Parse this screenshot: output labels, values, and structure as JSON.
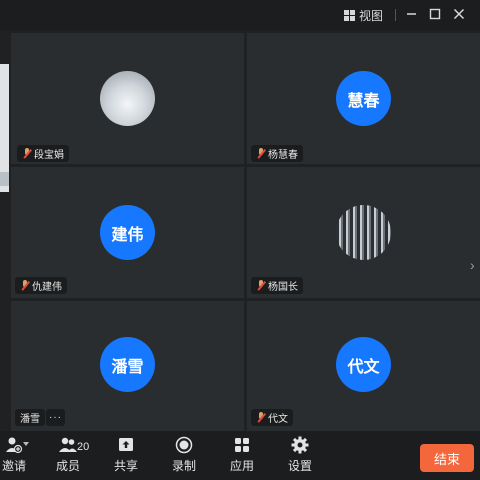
{
  "titlebar": {
    "view_label": "视图",
    "icons": [
      "grid-icon",
      "minimize-icon",
      "maximize-icon",
      "close-icon"
    ]
  },
  "participants": [
    {
      "name": "段宝娟",
      "avatar": "photo-snow",
      "muted": true
    },
    {
      "name": "杨慧春",
      "avatar_text": "慧春",
      "muted": true
    },
    {
      "name": "仇建伟",
      "avatar_text": "建伟",
      "muted": true
    },
    {
      "name": "杨国长",
      "avatar": "photo-crowd",
      "muted": true
    },
    {
      "name": "潘雪",
      "avatar_text": "潘雪",
      "muted": false,
      "more": "···"
    },
    {
      "name": "代文",
      "avatar_text": "代文",
      "muted": true
    }
  ],
  "toolbar": {
    "invite": "邀请",
    "members": "成员",
    "member_count": "20",
    "share": "共享",
    "record": "录制",
    "apps": "应用",
    "settings": "设置",
    "end": "结束"
  },
  "colors": {
    "avatar_blue": "#1677ff",
    "end_button": "#f4663c",
    "tile_bg": "#2a2d30"
  }
}
